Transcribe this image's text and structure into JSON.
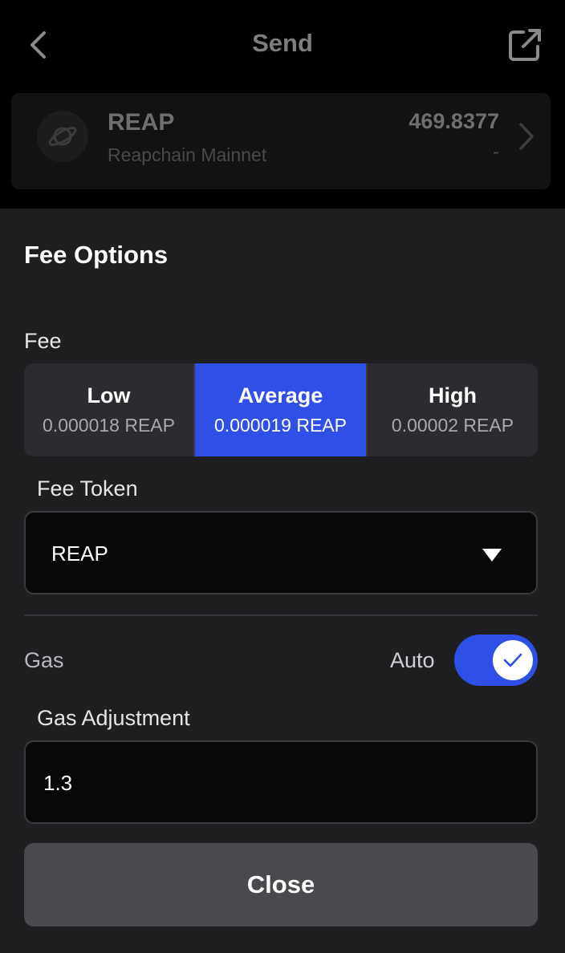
{
  "header": {
    "title": "Send",
    "back_icon": "chevron-left-icon",
    "external_icon": "external-link-icon"
  },
  "asset": {
    "name": "REAP",
    "chain": "Reapchain Mainnet",
    "balance": "469.8377",
    "value": "-"
  },
  "sheet": {
    "title": "Fee Options",
    "fee_label": "Fee",
    "fee_options": [
      {
        "name": "Low",
        "amount": "0.000018 REAP",
        "selected": false
      },
      {
        "name": "Average",
        "amount": "0.000019 REAP",
        "selected": true
      },
      {
        "name": "High",
        "amount": "0.00002 REAP",
        "selected": false
      }
    ],
    "fee_token_label": "Fee Token",
    "fee_token_value": "REAP",
    "gas_label": "Gas",
    "auto_label": "Auto",
    "auto_enabled": true,
    "gas_adjustment_label": "Gas Adjustment",
    "gas_adjustment_value": "1.3",
    "close_label": "Close"
  },
  "colors": {
    "accent": "#2e50e6",
    "sheet_bg": "#1f1f22"
  }
}
